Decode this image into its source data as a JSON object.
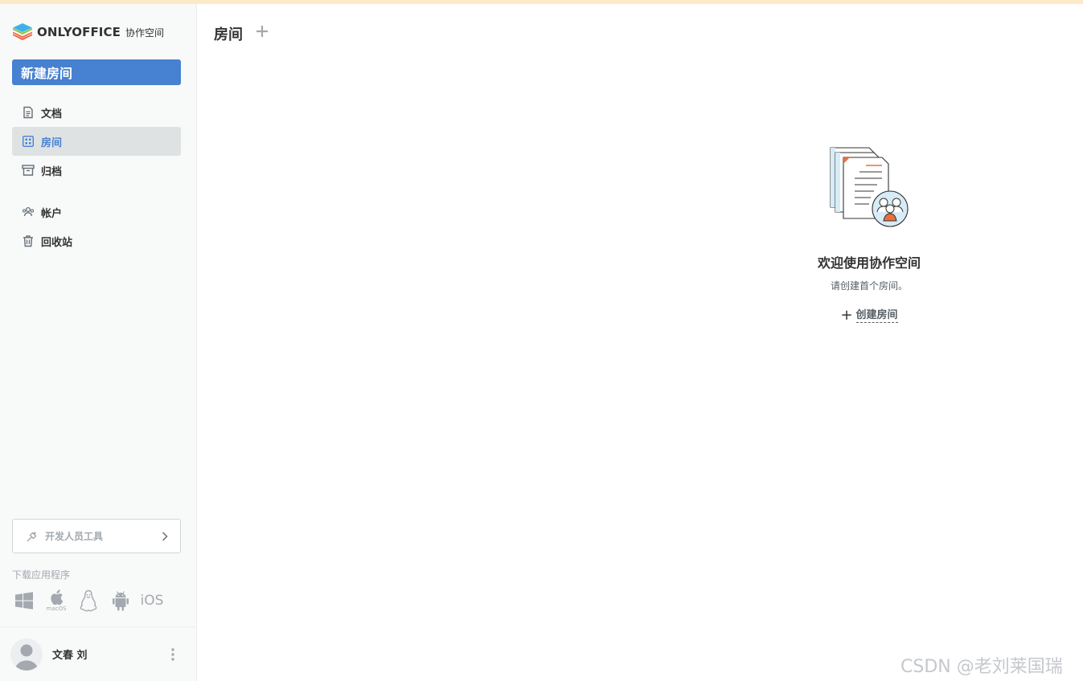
{
  "brand": {
    "name": "ONLYOFFICE",
    "subtitle": "协作空间"
  },
  "sidebar": {
    "new_room_label": "新建房间",
    "items": [
      {
        "label": "文档",
        "icon": "document-icon",
        "active": false
      },
      {
        "label": "房间",
        "icon": "rooms-grid-icon",
        "active": true
      },
      {
        "label": "归档",
        "icon": "archive-icon",
        "active": false
      },
      {
        "label": "帐户",
        "icon": "accounts-icon",
        "active": false
      },
      {
        "label": "回收站",
        "icon": "trash-icon",
        "active": false
      }
    ],
    "dev_tools_label": "开发人员工具",
    "download_label": "下载应用程序",
    "apps": [
      {
        "name": "windows-icon",
        "caption": ""
      },
      {
        "name": "macos-icon",
        "caption": "macOS"
      },
      {
        "name": "linux-icon",
        "caption": ""
      },
      {
        "name": "android-icon",
        "caption": ""
      },
      {
        "name": "ios-icon",
        "caption": "iOS"
      }
    ]
  },
  "profile": {
    "name": "文春 刘"
  },
  "main": {
    "title": "房间",
    "empty_state": {
      "title": "欢迎使用协作空间",
      "description": "请创建首个房间。",
      "action_label": "创建房间"
    }
  },
  "watermark": "CSDN @老刘莱国瑞",
  "colors": {
    "accent": "#4781d1",
    "active_bg": "#dfe2e3",
    "sidebar_bg": "#f8f9f9",
    "muted": "#a3a9ae",
    "top_banner": "#fbe9c8"
  }
}
